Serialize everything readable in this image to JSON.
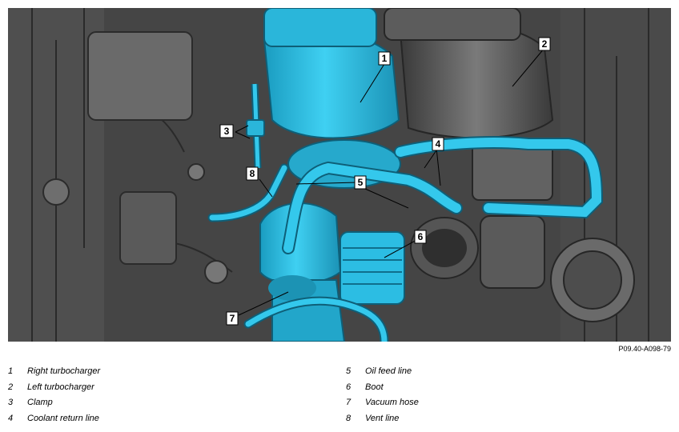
{
  "figure": {
    "reference": "P09.40-A098-79",
    "callouts": [
      "1",
      "2",
      "3",
      "4",
      "5",
      "6",
      "7",
      "8"
    ]
  },
  "legend": [
    {
      "num": "1",
      "text": "Right turbocharger"
    },
    {
      "num": "2",
      "text": "Left turbocharger"
    },
    {
      "num": "3",
      "text": "Clamp"
    },
    {
      "num": "4",
      "text": "Coolant return line"
    },
    {
      "num": "5",
      "text": "Oil feed line"
    },
    {
      "num": "6",
      "text": "Boot"
    },
    {
      "num": "7",
      "text": "Vacuum hose"
    },
    {
      "num": "8",
      "text": "Vent line"
    }
  ],
  "colors": {
    "highlight": "#2fc3e6",
    "highlight_dark": "#1a8fb0",
    "engine_gray": "#5e5e5e",
    "engine_dark": "#303030"
  }
}
